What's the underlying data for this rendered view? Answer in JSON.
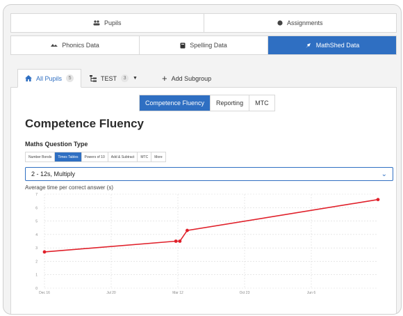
{
  "top_tabs": [
    {
      "label": "Pupils",
      "icon": "pupils-icon"
    },
    {
      "label": "Assignments",
      "icon": "assignments-icon"
    }
  ],
  "data_tabs": [
    {
      "label": "Phonics Data",
      "icon": "phonics-icon"
    },
    {
      "label": "Spelling Data",
      "icon": "spelling-icon"
    },
    {
      "label": "MathShed Data",
      "icon": "mathshed-icon",
      "active": true
    }
  ],
  "pupil_tabs": {
    "all": {
      "label": "All Pupils",
      "count": "5"
    },
    "test": {
      "label": "TEST",
      "count": "3"
    },
    "add": {
      "label": "Add Subgroup"
    }
  },
  "segments": [
    "Competence Fluency",
    "Reporting",
    "MTC"
  ],
  "page_title": "Competence Fluency",
  "question_type_label": "Maths Question Type",
  "question_types": [
    "Number Bonds",
    "Times Tables",
    "Powers of 10",
    "Add & Subtract",
    "MTC",
    "More"
  ],
  "selected_question": "2 - 12s, Multiply",
  "colors": {
    "accent": "#2f6fc2",
    "line": "#e0202a"
  },
  "chart_data": {
    "type": "line",
    "title": "",
    "ylabel": "Average time per correct answer (s)",
    "xlabel": "",
    "ylim": [
      0,
      7
    ],
    "yticks": [
      "0",
      "1",
      "2",
      "3",
      "4",
      "5",
      "6",
      "7"
    ],
    "xticks": [
      "Dec 16",
      "Jul 20",
      "Mar 12",
      "Oct 23",
      "Jun 6"
    ],
    "xtick_pos": [
      0,
      1,
      2,
      3,
      4
    ],
    "series": [
      {
        "x": [
          0,
          1.97,
          2.03,
          2.14,
          5.0
        ],
        "y": [
          2.7,
          3.5,
          3.5,
          4.3,
          6.6
        ]
      }
    ],
    "grid": true
  }
}
